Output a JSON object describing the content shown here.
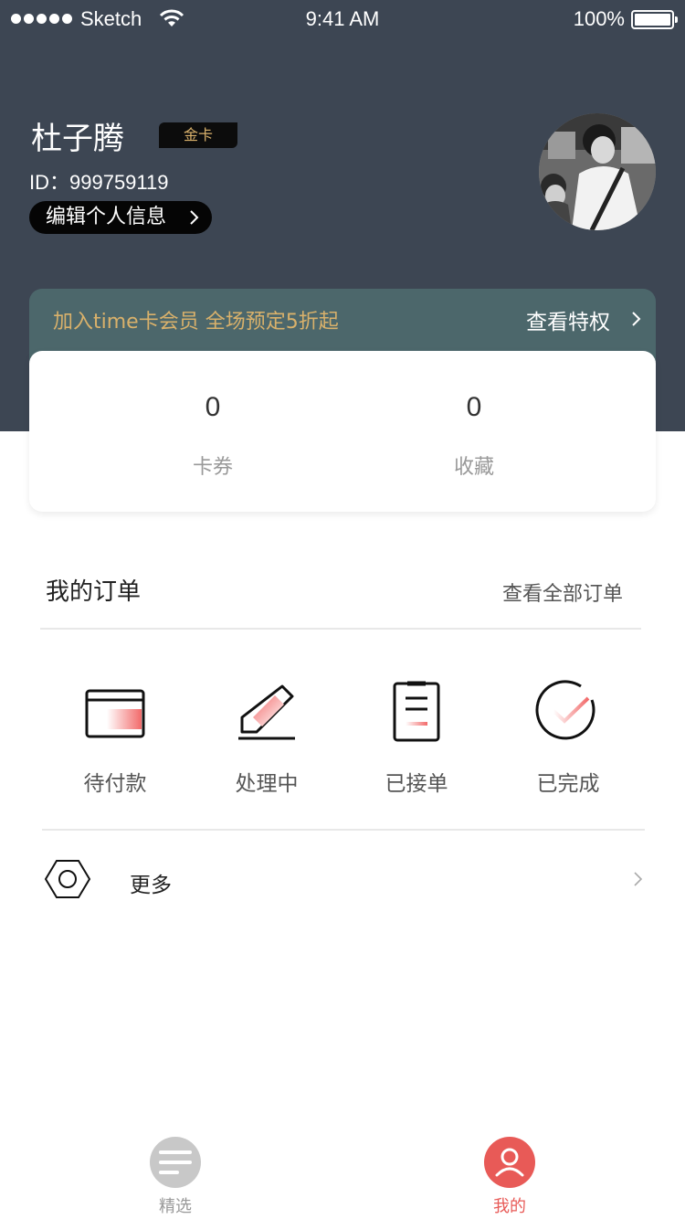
{
  "status_bar": {
    "carrier": "Sketch",
    "time": "9:41 AM",
    "battery": "100%"
  },
  "profile": {
    "name": "杜子腾",
    "badge": "金卡",
    "id": "ID：999759119",
    "edit_label": "编辑个人信息"
  },
  "membership": {
    "promo": "加入time卡会员 全场预定5折起",
    "link": "查看特权"
  },
  "stats": [
    {
      "value": "0",
      "label": "卡券"
    },
    {
      "value": "0",
      "label": "收藏"
    }
  ],
  "orders": {
    "title": "我的订单",
    "view_all": "查看全部订单",
    "items": [
      {
        "label": "待付款",
        "icon": "wallet-icon"
      },
      {
        "label": "处理中",
        "icon": "pencil-icon"
      },
      {
        "label": "已接单",
        "icon": "clipboard-icon"
      },
      {
        "label": "已完成",
        "icon": "check-circle-icon"
      }
    ]
  },
  "more": {
    "label": "更多",
    "icon": "hexagon-nut-icon"
  },
  "tabbar": {
    "items": [
      {
        "label": "精选",
        "icon": "menu-lines-icon",
        "active": false
      },
      {
        "label": "我的",
        "icon": "user-icon",
        "active": true
      }
    ]
  },
  "colors": {
    "header_bg": "#3d4653",
    "accent": "#e85a57",
    "gold": "#d9b16b",
    "banner": "#4c676b"
  }
}
